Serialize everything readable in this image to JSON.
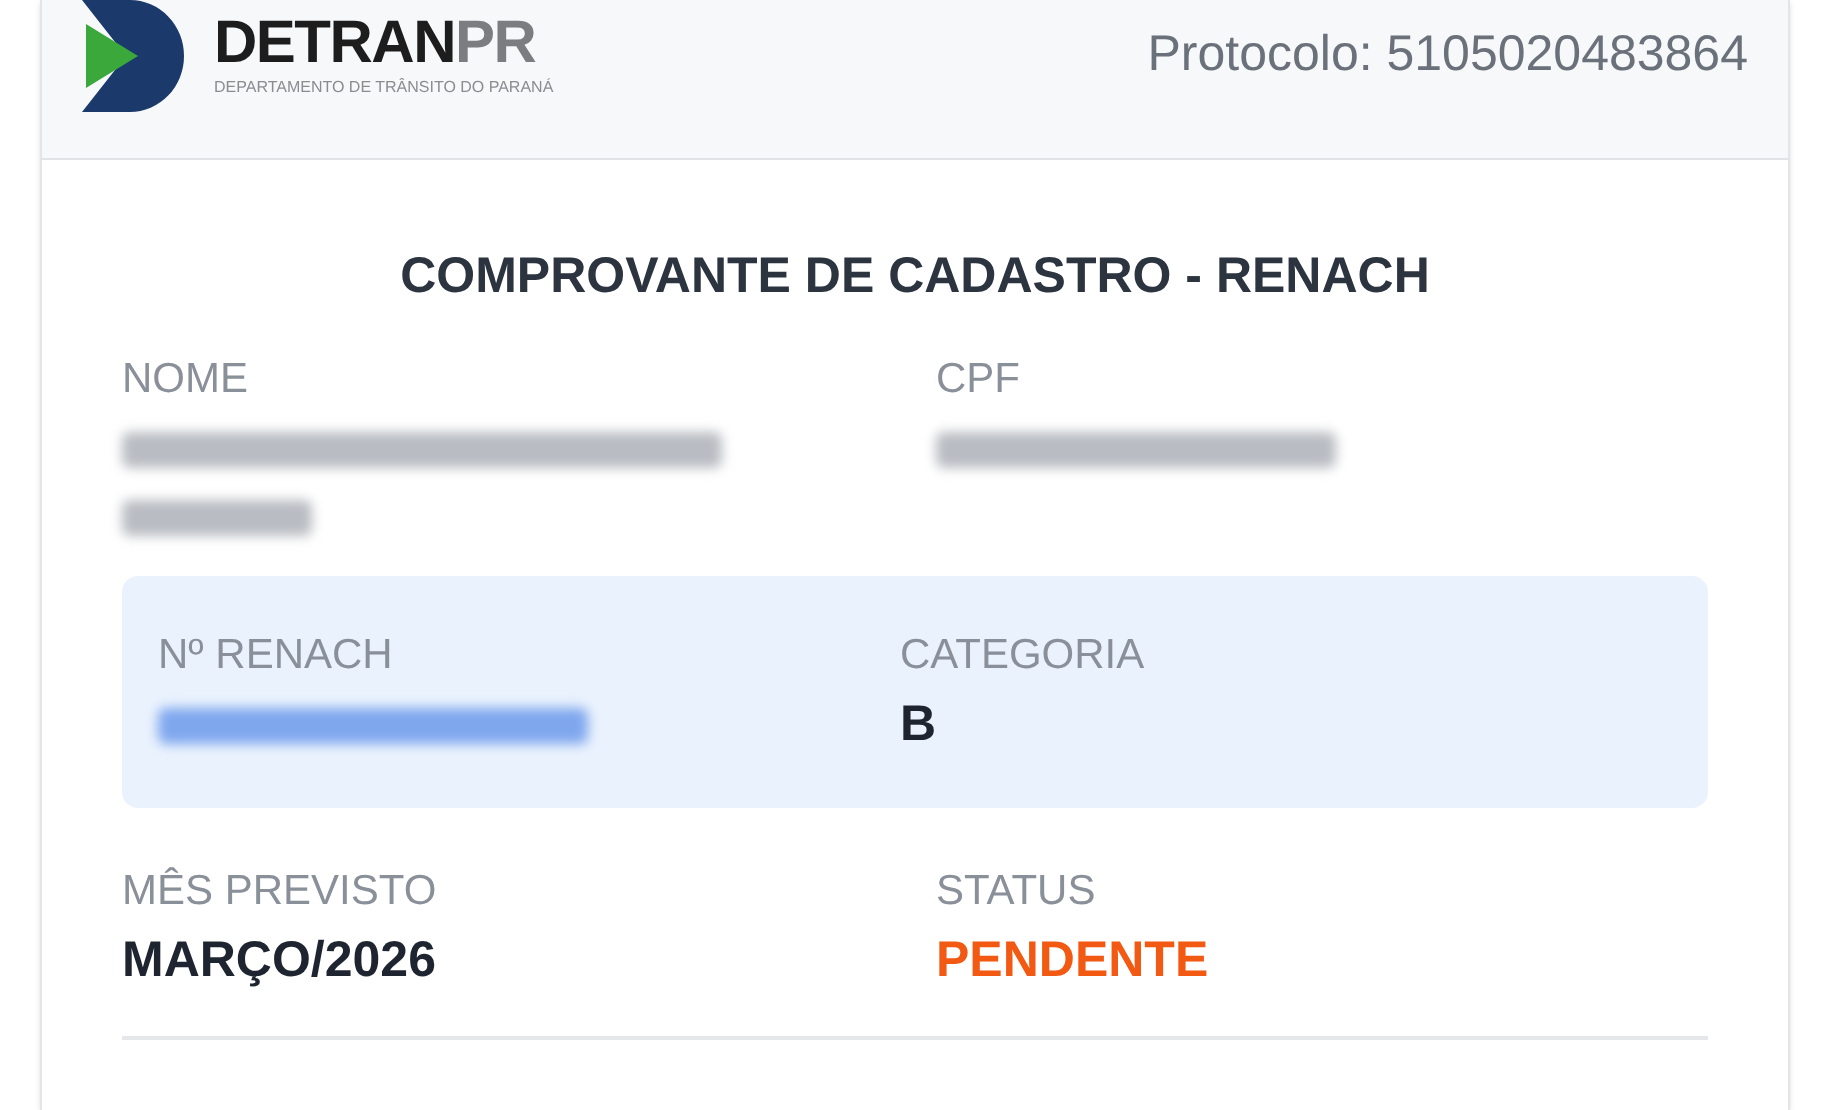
{
  "header": {
    "logo": {
      "name": "DETRAN",
      "suffix": "PR",
      "subtitle": "DEPARTAMENTO DE TRÂNSITO DO PARANÁ"
    },
    "protocol": "Protocolo: 5105020483864"
  },
  "title": "COMPROVANTE DE CADASTRO - RENACH",
  "rows": [
    {
      "highlight": false,
      "fields": [
        {
          "label": "NOME",
          "kind": "blurred-two-line"
        },
        {
          "label": "CPF",
          "kind": "blurred"
        }
      ]
    },
    {
      "highlight": true,
      "fields": [
        {
          "label": "Nº RENACH",
          "kind": "blurred-link"
        },
        {
          "label": "CATEGORIA",
          "kind": "text",
          "value": "B"
        }
      ]
    },
    {
      "highlight": false,
      "fields": [
        {
          "label": "MÊS PREVISTO",
          "kind": "text",
          "value": "MARÇO/2026"
        },
        {
          "label": "STATUS",
          "kind": "status",
          "value": "PENDENTE"
        }
      ]
    }
  ]
}
